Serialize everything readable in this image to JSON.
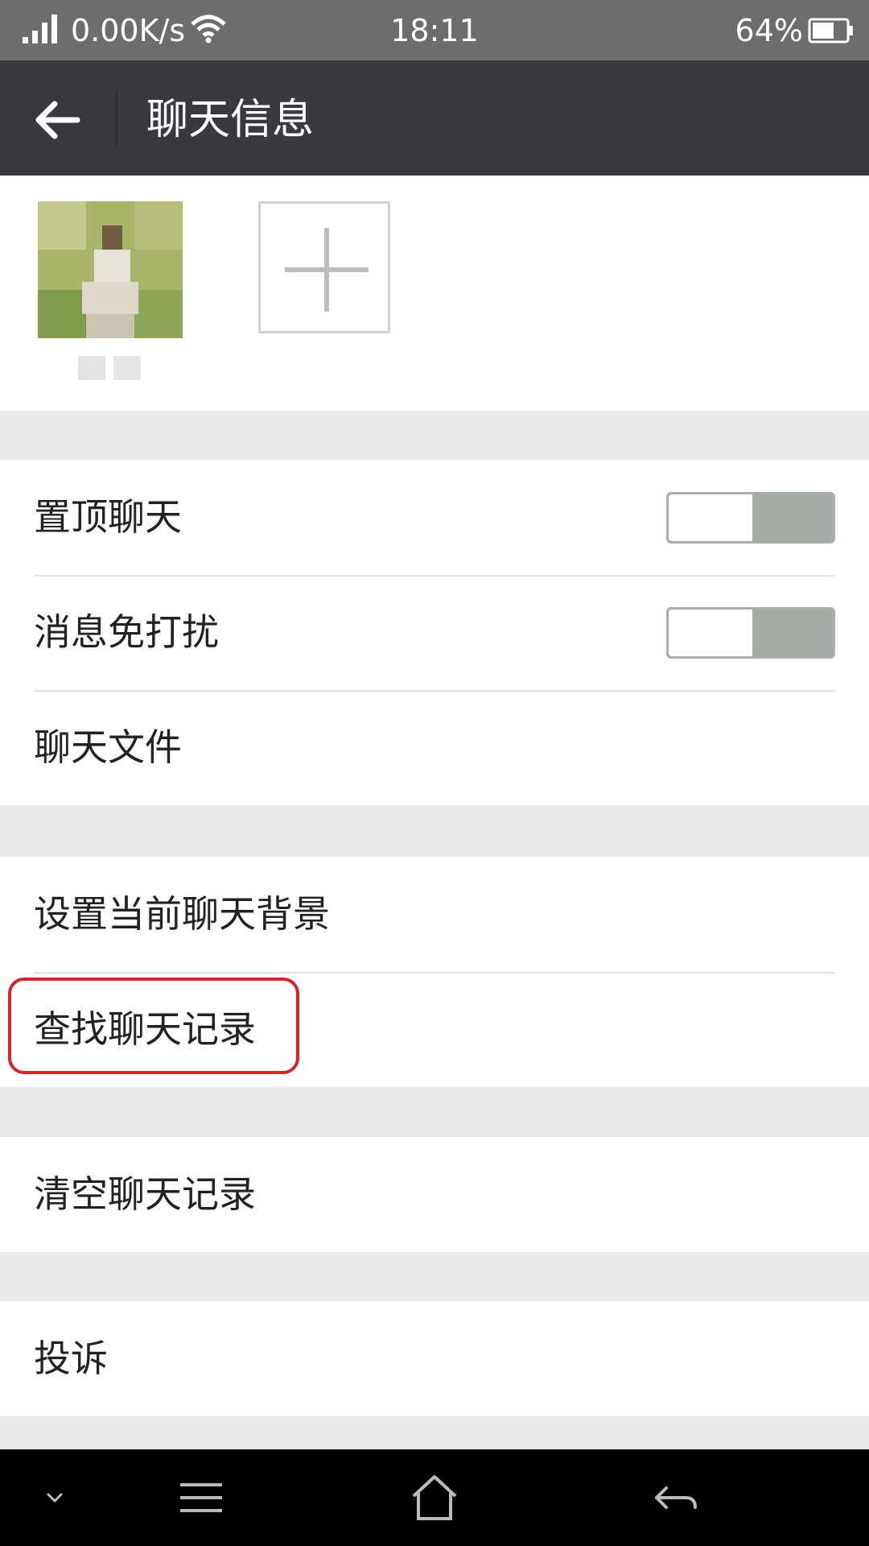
{
  "status_bar": {
    "network_speed": "0.00K/s",
    "time": "18:11",
    "battery": "64%",
    "icons": [
      "signal-icon",
      "wifi-icon",
      "battery-icon"
    ]
  },
  "header": {
    "title": "聊天信息",
    "back_icon": "back-arrow-icon"
  },
  "members": {
    "add_icon": "plus-icon"
  },
  "settings": {
    "pin_chat": {
      "label": "置顶聊天",
      "on": false
    },
    "mute": {
      "label": "消息免打扰",
      "on": false
    },
    "chat_files": "聊天文件",
    "set_background": "设置当前聊天背景",
    "search_history": "查找聊天记录",
    "clear_history": "清空聊天记录",
    "report": "投诉"
  },
  "nav_bar": {
    "icons": [
      "chevron-down-icon",
      "menu-icon",
      "home-icon",
      "return-icon"
    ]
  },
  "colors": {
    "title_bar": "#393a3f",
    "status_bar": "#6d6d6d",
    "page_bg": "#e9e9e9",
    "highlight": "#d6222d",
    "toggle_off": "#a5aca5"
  }
}
